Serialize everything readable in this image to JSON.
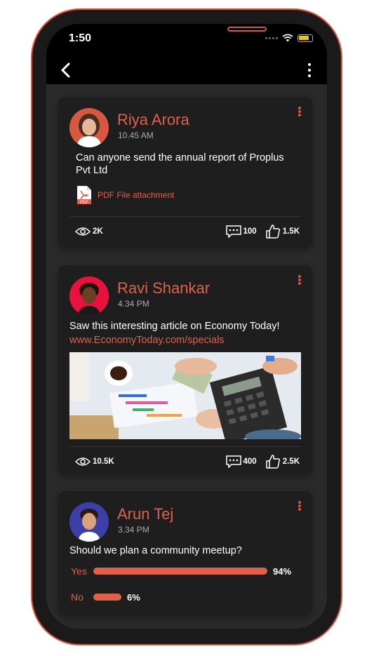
{
  "status_bar": {
    "time": "1:50"
  },
  "colors": {
    "accent": "#e0614a",
    "card_bg": "#1e1e1e",
    "feed_bg": "#2a2a2a"
  },
  "header": {
    "back_icon": "chevron-left-icon",
    "menu_icon": "kebab-icon"
  },
  "posts": [
    {
      "author": "Riya Arora",
      "time": "10.45 AM",
      "text": "Can anyone send the annual report of Proplus Pvt Ltd",
      "attachment_label": "PDF File attachment",
      "views": "2K",
      "comments": "100",
      "likes": "1.5K"
    },
    {
      "author": "Ravi Shankar",
      "time": "4.34 PM",
      "text": "Saw this interesting article on Economy Today!",
      "link": "www.EconomyToday.com/specials",
      "views": "10.5K",
      "comments": "400",
      "likes": "2.5K"
    },
    {
      "author": "Arun Tej",
      "time": "3.34 PM",
      "text": "Should we plan a community meetup?",
      "poll": [
        {
          "label": "Yes",
          "percent": 94,
          "percent_label": "94%"
        },
        {
          "label": "No",
          "percent": 6,
          "percent_label": "6%"
        }
      ]
    }
  ]
}
